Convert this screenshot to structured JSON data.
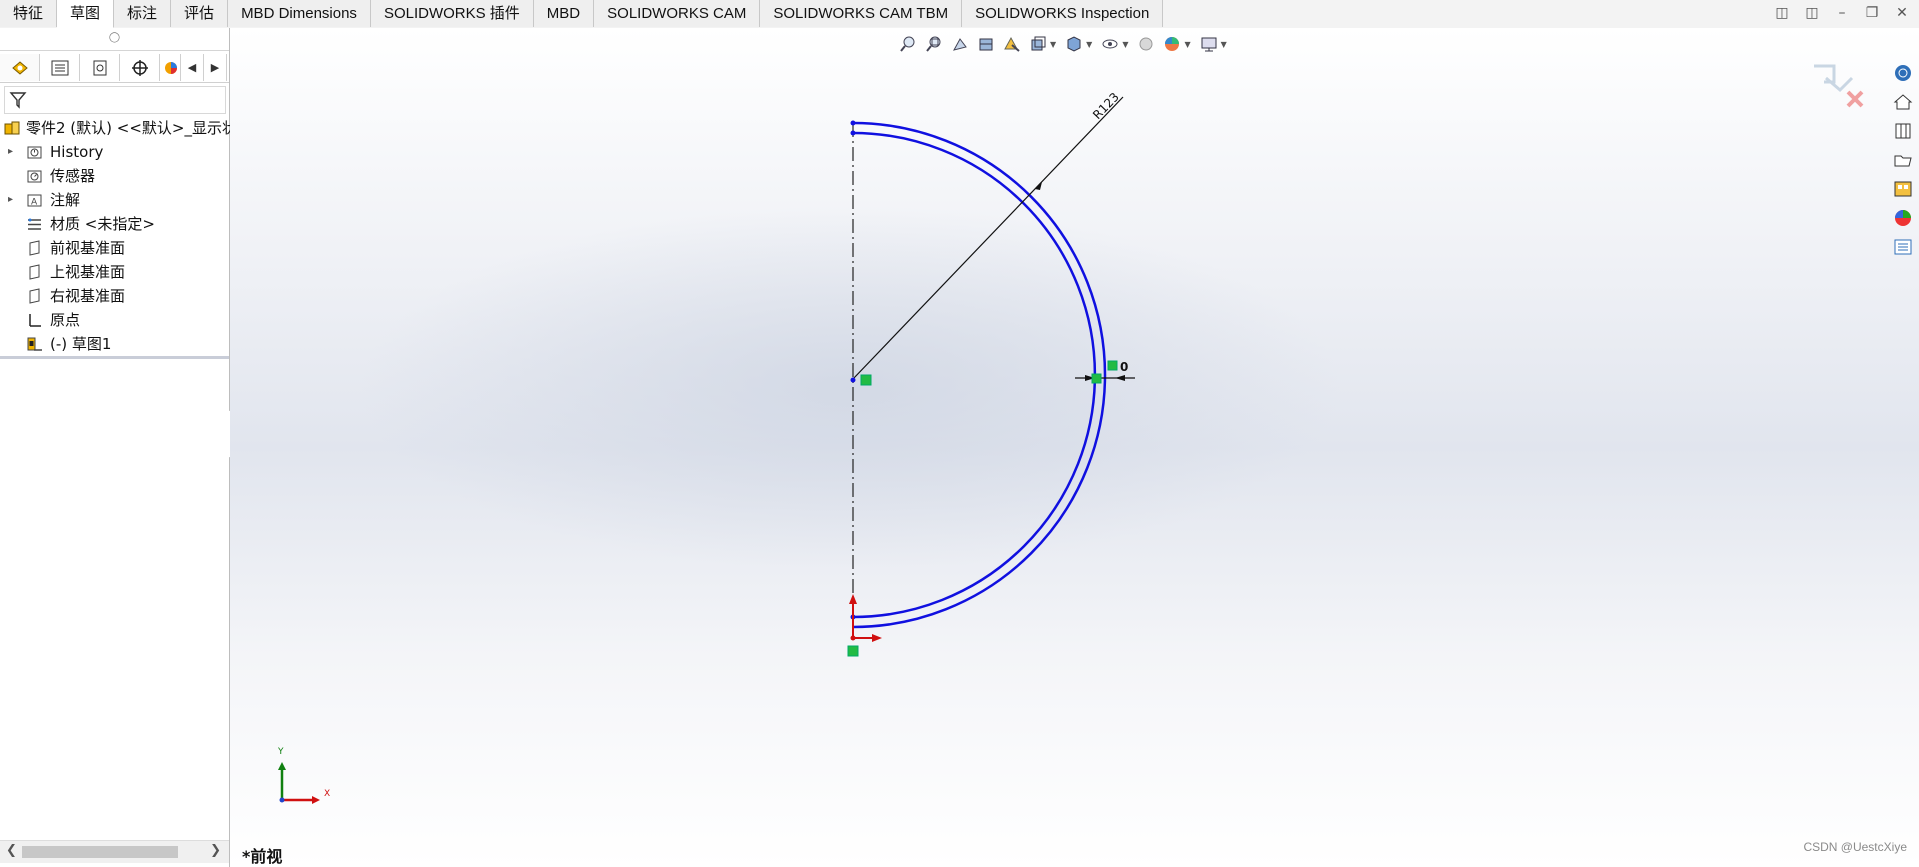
{
  "tabs": [
    {
      "label": "特征",
      "active": false
    },
    {
      "label": "草图",
      "active": true
    },
    {
      "label": "标注",
      "active": false
    },
    {
      "label": "评估",
      "active": false
    },
    {
      "label": "MBD Dimensions",
      "active": false
    },
    {
      "label": "SOLIDWORKS 插件",
      "active": false
    },
    {
      "label": "MBD",
      "active": false
    },
    {
      "label": "SOLIDWORKS CAM",
      "active": false
    },
    {
      "label": "SOLIDWORKS CAM TBM",
      "active": false
    },
    {
      "label": "SOLIDWORKS Inspection",
      "active": false
    }
  ],
  "feature_tree": {
    "root": "零件2 (默认) <<默认>_显示状",
    "items": [
      {
        "label": "History",
        "expandable": true,
        "icon": "history-folder-icon"
      },
      {
        "label": "传感器",
        "expandable": false,
        "icon": "sensor-icon"
      },
      {
        "label": "注解",
        "expandable": true,
        "icon": "annotation-icon"
      },
      {
        "label": "材质 <未指定>",
        "expandable": false,
        "icon": "material-icon"
      },
      {
        "label": "前视基准面",
        "expandable": false,
        "icon": "plane-icon"
      },
      {
        "label": "上视基准面",
        "expandable": false,
        "icon": "plane-icon"
      },
      {
        "label": "右视基准面",
        "expandable": false,
        "icon": "plane-icon"
      },
      {
        "label": "原点",
        "expandable": false,
        "icon": "origin-icon"
      },
      {
        "label": "(-) 草图1",
        "expandable": false,
        "icon": "sketch-icon"
      }
    ]
  },
  "sketch": {
    "radius_dimension": "R123",
    "thickness_dimension": "0",
    "triad_x": "X",
    "triad_y": "Y",
    "colors": {
      "sketch": "#1010e0",
      "dimension": "#111111",
      "relation": "#22bb44",
      "triad_x": "#d01010",
      "triad_y": "#108010"
    }
  },
  "view_name": "*前视",
  "watermark": "CSDN @UestcXiye"
}
